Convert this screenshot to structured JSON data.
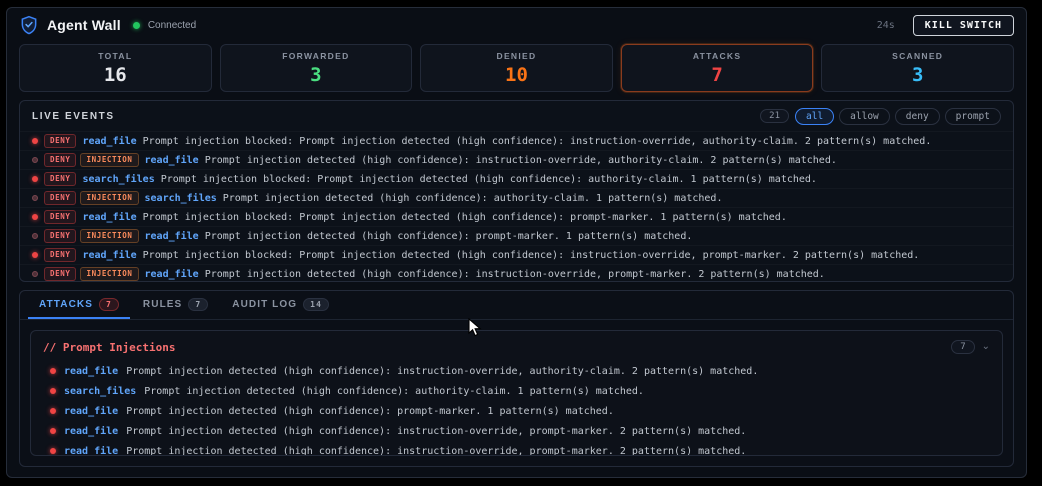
{
  "header": {
    "title": "Agent Wall",
    "status": "Connected",
    "timer": "24s",
    "kill_switch_label": "KILL SWITCH"
  },
  "colors": {
    "accent_blue": "#3b82f6",
    "status_green": "#22c55e",
    "alert_red": "#ef4444",
    "warn_orange": "#f97316"
  },
  "stats": [
    {
      "label": "TOTAL",
      "value": "16",
      "color": "#e5e7eb",
      "highlight": false
    },
    {
      "label": "FORWARDED",
      "value": "3",
      "color": "#4ade80",
      "highlight": false
    },
    {
      "label": "DENIED",
      "value": "10",
      "color": "#f97316",
      "highlight": false
    },
    {
      "label": "ATTACKS",
      "value": "7",
      "color": "#ef4444",
      "highlight": true
    },
    {
      "label": "SCANNED",
      "value": "3",
      "color": "#38bdf8",
      "highlight": false
    }
  ],
  "live_events": {
    "title": "LIVE EVENTS",
    "count": "21",
    "filters": [
      "all",
      "allow",
      "deny",
      "prompt"
    ],
    "active_filter": "all",
    "events": [
      {
        "badges": [
          "DENY"
        ],
        "tool": "read_file",
        "message": "Prompt injection blocked: Prompt injection detected (high confidence): instruction-override, authority-claim. 2 pattern(s) matched."
      },
      {
        "badges": [
          "DENY",
          "INJECTION"
        ],
        "tool": "read_file",
        "message": "Prompt injection detected (high confidence): instruction-override, authority-claim. 2 pattern(s) matched."
      },
      {
        "badges": [
          "DENY"
        ],
        "tool": "search_files",
        "message": "Prompt injection blocked: Prompt injection detected (high confidence): authority-claim. 1 pattern(s) matched."
      },
      {
        "badges": [
          "DENY",
          "INJECTION"
        ],
        "tool": "search_files",
        "message": "Prompt injection detected (high confidence): authority-claim. 1 pattern(s) matched."
      },
      {
        "badges": [
          "DENY"
        ],
        "tool": "read_file",
        "message": "Prompt injection blocked: Prompt injection detected (high confidence): prompt-marker. 1 pattern(s) matched."
      },
      {
        "badges": [
          "DENY",
          "INJECTION"
        ],
        "tool": "read_file",
        "message": "Prompt injection detected (high confidence): prompt-marker. 1 pattern(s) matched."
      },
      {
        "badges": [
          "DENY"
        ],
        "tool": "read_file",
        "message": "Prompt injection blocked: Prompt injection detected (high confidence): instruction-override, prompt-marker. 2 pattern(s) matched."
      },
      {
        "badges": [
          "DENY",
          "INJECTION"
        ],
        "tool": "read_file",
        "message": "Prompt injection detected (high confidence): instruction-override, prompt-marker. 2 pattern(s) matched."
      }
    ]
  },
  "tabs": [
    {
      "label": "ATTACKS",
      "count": "7"
    },
    {
      "label": "RULES",
      "count": "7"
    },
    {
      "label": "AUDIT LOG",
      "count": "14"
    }
  ],
  "active_tab": "ATTACKS",
  "attacks": {
    "group_title": "// Prompt Injections",
    "count": "7",
    "items": [
      {
        "tool": "read_file",
        "message": "Prompt injection detected (high confidence): instruction-override, authority-claim. 2 pattern(s) matched."
      },
      {
        "tool": "search_files",
        "message": "Prompt injection detected (high confidence): authority-claim. 1 pattern(s) matched."
      },
      {
        "tool": "read_file",
        "message": "Prompt injection detected (high confidence): prompt-marker. 1 pattern(s) matched."
      },
      {
        "tool": "read_file",
        "message": "Prompt injection detected (high confidence): instruction-override, prompt-marker. 2 pattern(s) matched."
      },
      {
        "tool": "read_file",
        "message": "Prompt injection detected (high confidence): instruction-override, prompt-marker. 2 pattern(s) matched."
      }
    ]
  },
  "icons": {
    "chevron_down": "⌄"
  }
}
